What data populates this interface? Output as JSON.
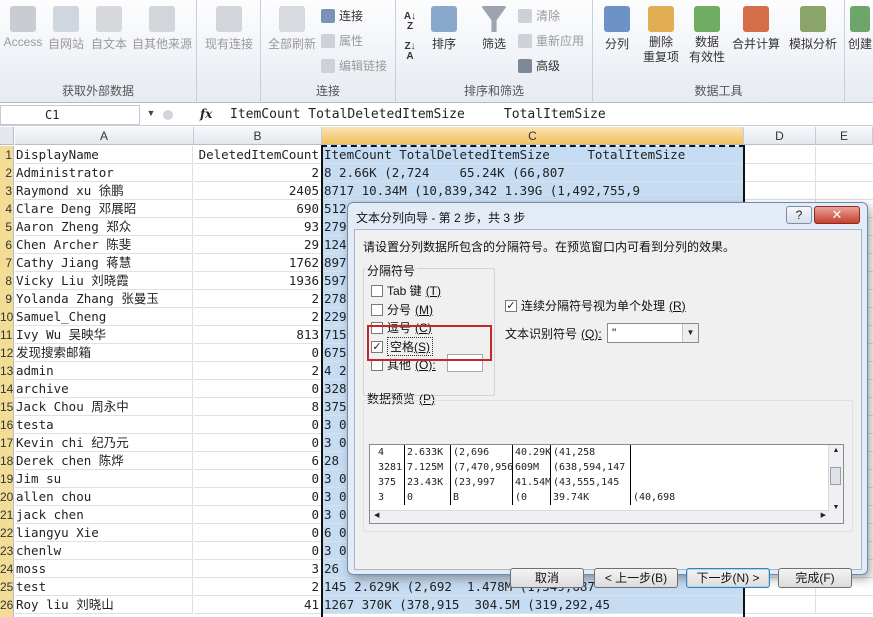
{
  "ribbon": {
    "groups": [
      {
        "label": "获取外部数据"
      },
      {
        "label": "连接"
      },
      {
        "label": "排序和筛选"
      },
      {
        "label": "数据工具"
      }
    ],
    "buttons": {
      "access": "Access",
      "web": "自网站",
      "text": "自文本",
      "other_sources": "自其他来源",
      "existing": "现有连接",
      "refresh_all": "全部刷新",
      "connections": "连接",
      "properties": "属性",
      "edit_links": "编辑链接",
      "sort": "排序",
      "filter": "筛选",
      "clear": "清除",
      "reapply": "重新应用",
      "advanced": "高级",
      "text_to_columns": "分列",
      "remove_dup_1": "删除",
      "remove_dup_2": "重复项",
      "validation_1": "数据",
      "validation_2": "有效性",
      "consolidate": "合并计算",
      "what_if": "模拟分析",
      "create": "创建"
    }
  },
  "formula_bar": {
    "name_box": "C1",
    "fx": "fx",
    "content": "ItemCount TotalDeletedItemSize     TotalItemSize"
  },
  "columns": [
    "A",
    "B",
    "C",
    "D",
    "E"
  ],
  "rows": [
    {
      "n": "1",
      "a": "DisplayName",
      "b": "DeletedItemCount",
      "c": "ItemCount TotalDeletedItemSize     TotalItemSize"
    },
    {
      "n": "2",
      "a": "Administrator",
      "b": "2",
      "c": "8 2.66K (2,724    65.24K (66,807"
    },
    {
      "n": "3",
      "a": "Raymond xu 徐鹏",
      "b": "2405",
      "c": "8717 10.34M (10,839,342 1.39G (1,492,755,9"
    },
    {
      "n": "4",
      "a": "Clare Deng 邓展昭",
      "b": "690",
      "c": "512"
    },
    {
      "n": "5",
      "a": "Aaron Zheng 郑众",
      "b": "93",
      "c": "279"
    },
    {
      "n": "6",
      "a": "Chen Archer 陈斐",
      "b": "29",
      "c": "124"
    },
    {
      "n": "7",
      "a": "Cathy Jiang 蒋慧",
      "b": "1762",
      "c": "897"
    },
    {
      "n": "8",
      "a": "Vicky Liu 刘晓霞",
      "b": "1936",
      "c": "597"
    },
    {
      "n": "9",
      "a": "Yolanda Zhang 张曼玉",
      "b": "2",
      "c": "278"
    },
    {
      "n": "10",
      "a": "Samuel_Cheng",
      "b": "2",
      "c": "229"
    },
    {
      "n": "11",
      "a": "Ivy Wu 吴映华",
      "b": "813",
      "c": "715"
    },
    {
      "n": "12",
      "a": "发现搜索邮箱",
      "b": "0",
      "c": "675"
    },
    {
      "n": "13",
      "a": "admin",
      "b": "2",
      "c": "4 2"
    },
    {
      "n": "14",
      "a": "archive",
      "b": "0",
      "c": "328"
    },
    {
      "n": "15",
      "a": "Jack Chou 周永中",
      "b": "8",
      "c": "375"
    },
    {
      "n": "16",
      "a": "testa",
      "b": "0",
      "c": "3 0"
    },
    {
      "n": "17",
      "a": "Kevin chi 纪乃元",
      "b": "0",
      "c": "3 0"
    },
    {
      "n": "18",
      "a": "Derek chen 陈烨",
      "b": "6",
      "c": "28"
    },
    {
      "n": "19",
      "a": "Jim su",
      "b": "0",
      "c": "3 0"
    },
    {
      "n": "20",
      "a": "allen chou",
      "b": "0",
      "c": "3 0"
    },
    {
      "n": "21",
      "a": "jack chen",
      "b": "0",
      "c": "3 0"
    },
    {
      "n": "22",
      "a": "liangyu Xie",
      "b": "0",
      "c": "6 0"
    },
    {
      "n": "23",
      "a": "chenlw",
      "b": "0",
      "c": "3 0"
    },
    {
      "n": "24",
      "a": "moss",
      "b": "3",
      "c": "26"
    },
    {
      "n": "25",
      "a": "test",
      "b": "2",
      "c": "145 2.629K (2,692  1.478M (1,549,687"
    },
    {
      "n": "26",
      "a": "Roy liu 刘晓山",
      "b": "41",
      "c": "1267 370K (378,915  304.5M (319,292,45"
    }
  ],
  "dialog": {
    "title": "文本分列向导 - 第 2 步，共 3 步",
    "help": "?",
    "close": "✕",
    "instruction": "请设置分列数据所包含的分隔符号。在预览窗口内可看到分列的效果。",
    "delimiters_legend": "分隔符号",
    "tab": {
      "label": "Tab 键",
      "key": "(T)",
      "checked": false
    },
    "semicolon": {
      "label": "分号",
      "key": "(M)",
      "checked": false
    },
    "comma": {
      "label": "逗号",
      "key": "(C)",
      "checked": false
    },
    "space": {
      "label": "空格",
      "key": "(S)",
      "checked": true
    },
    "other": {
      "label": "其他",
      "key": "(O):",
      "checked": false
    },
    "consecutive": {
      "label": "连续分隔符号视为单个处理",
      "key": "(R)",
      "checked": true
    },
    "text_qualifier_label": "文本识别符号",
    "text_qualifier_key": "(Q):",
    "text_qualifier_value": "\"",
    "preview_legend": "数据预览",
    "preview_key": "(P)",
    "preview_rows": [
      [
        "4",
        "2.633K",
        "(2,696",
        "40.29K",
        "(41,258",
        ""
      ],
      [
        "3281",
        "7.125M",
        "(7,470,956",
        "609M",
        "(638,594,147",
        ""
      ],
      [
        "375",
        "23.43K",
        "(23,997",
        "41.54M",
        "(43,555,145",
        ""
      ],
      [
        "3",
        "0",
        "B",
        "(0",
        "39.74K",
        "(40,698"
      ]
    ],
    "buttons": {
      "cancel": "取消",
      "back": "< 上一步(B)",
      "next": "下一步(N) >",
      "finish": "完成(F)"
    }
  },
  "colors": {
    "selection": "#c6dcf3",
    "row_header_selected": "#f3dc95",
    "highlight_box": "#c4262b"
  }
}
